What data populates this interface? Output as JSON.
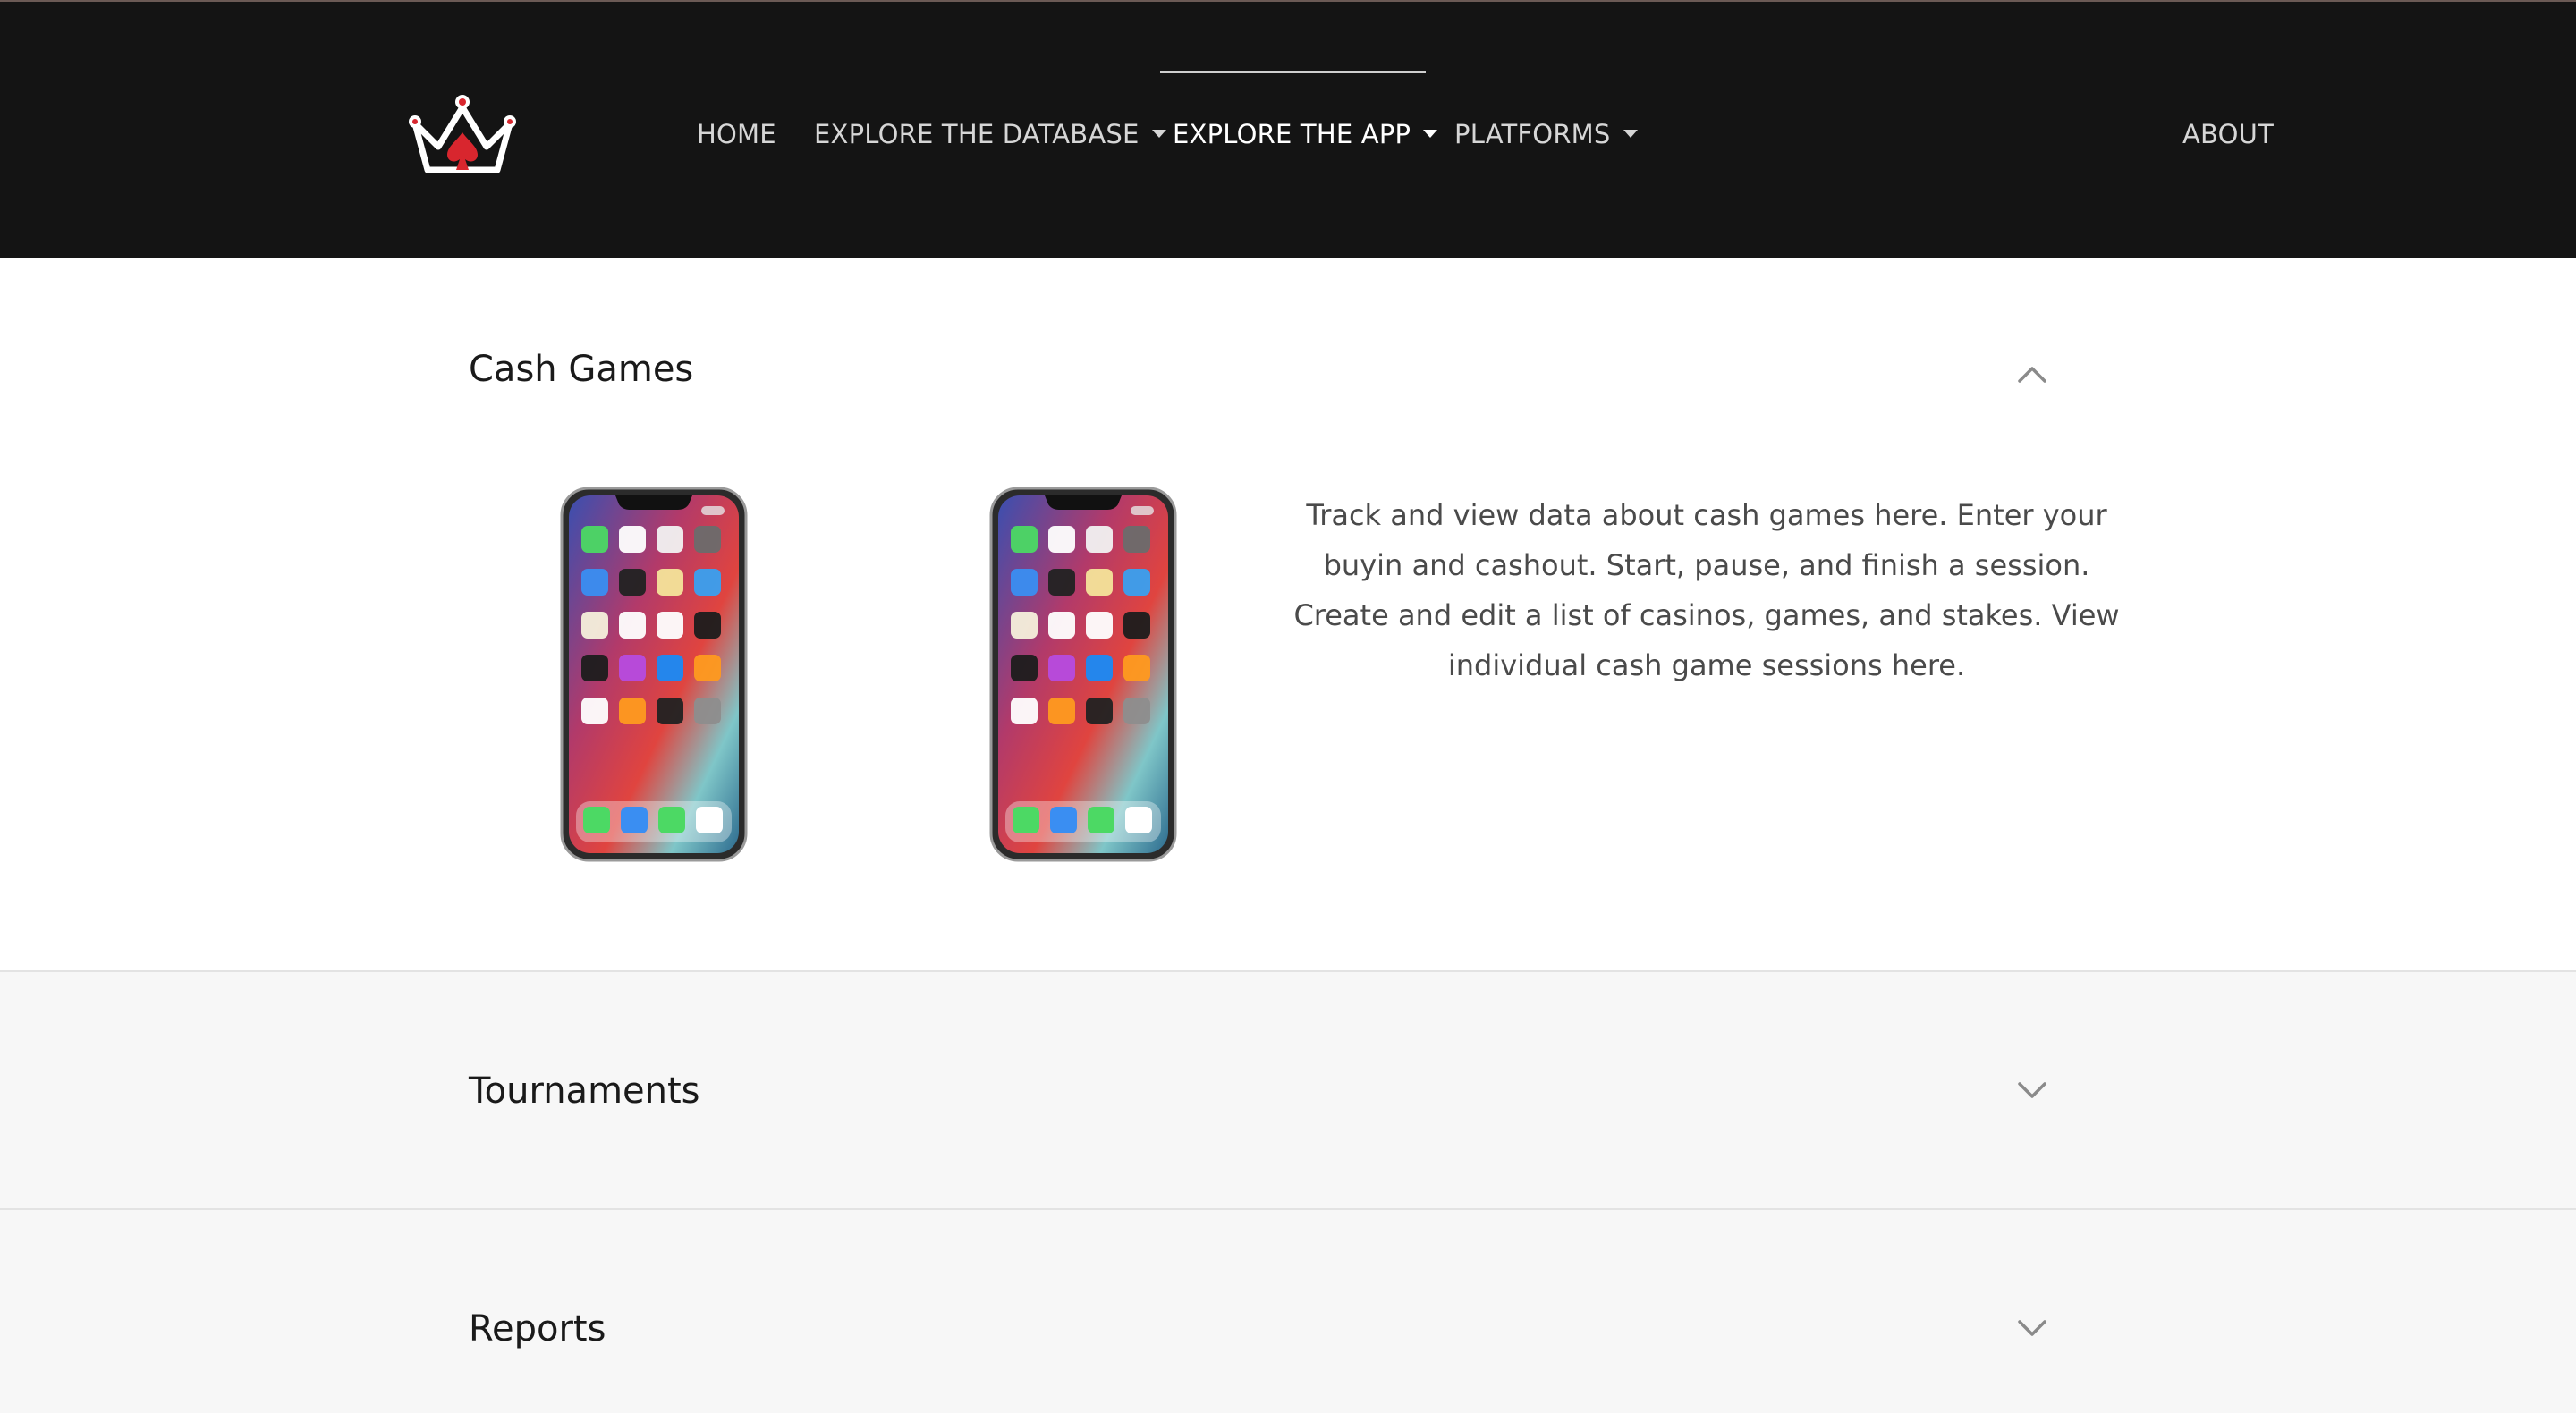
{
  "navbar": {
    "logo_icon": "crown-spade-logo",
    "items": [
      {
        "label": "HOME",
        "dropdown": false,
        "active": false
      },
      {
        "label": "EXPLORE THE DATABASE",
        "dropdown": true,
        "active": false
      },
      {
        "label": "EXPLORE THE APP",
        "dropdown": true,
        "active": true
      },
      {
        "label": "PLATFORMS",
        "dropdown": true,
        "active": false
      }
    ],
    "about_label": "ABOUT"
  },
  "sections": [
    {
      "title": "Cash Games",
      "expanded": true,
      "chevron_icon": "chevron-up-icon",
      "description": "Track and view data about cash games here. Enter your buyin and cashout. Start, pause, and finish a session. Create and edit a list of casinos, games, and stakes. View individual cash game sessions here.",
      "images": [
        "iphone-screenshot",
        "iphone-screenshot"
      ]
    },
    {
      "title": "Tournaments",
      "expanded": false,
      "chevron_icon": "chevron-down-icon"
    },
    {
      "title": "Reports",
      "expanded": false,
      "chevron_icon": "chevron-down-icon"
    }
  ],
  "colors": {
    "navbar_bg": "#141414",
    "nav_text": "#d6d6d6",
    "logo_red": "#d8262e",
    "collapsed_section_bg": "#f7f7f7",
    "description_text": "#4a4a4a"
  }
}
